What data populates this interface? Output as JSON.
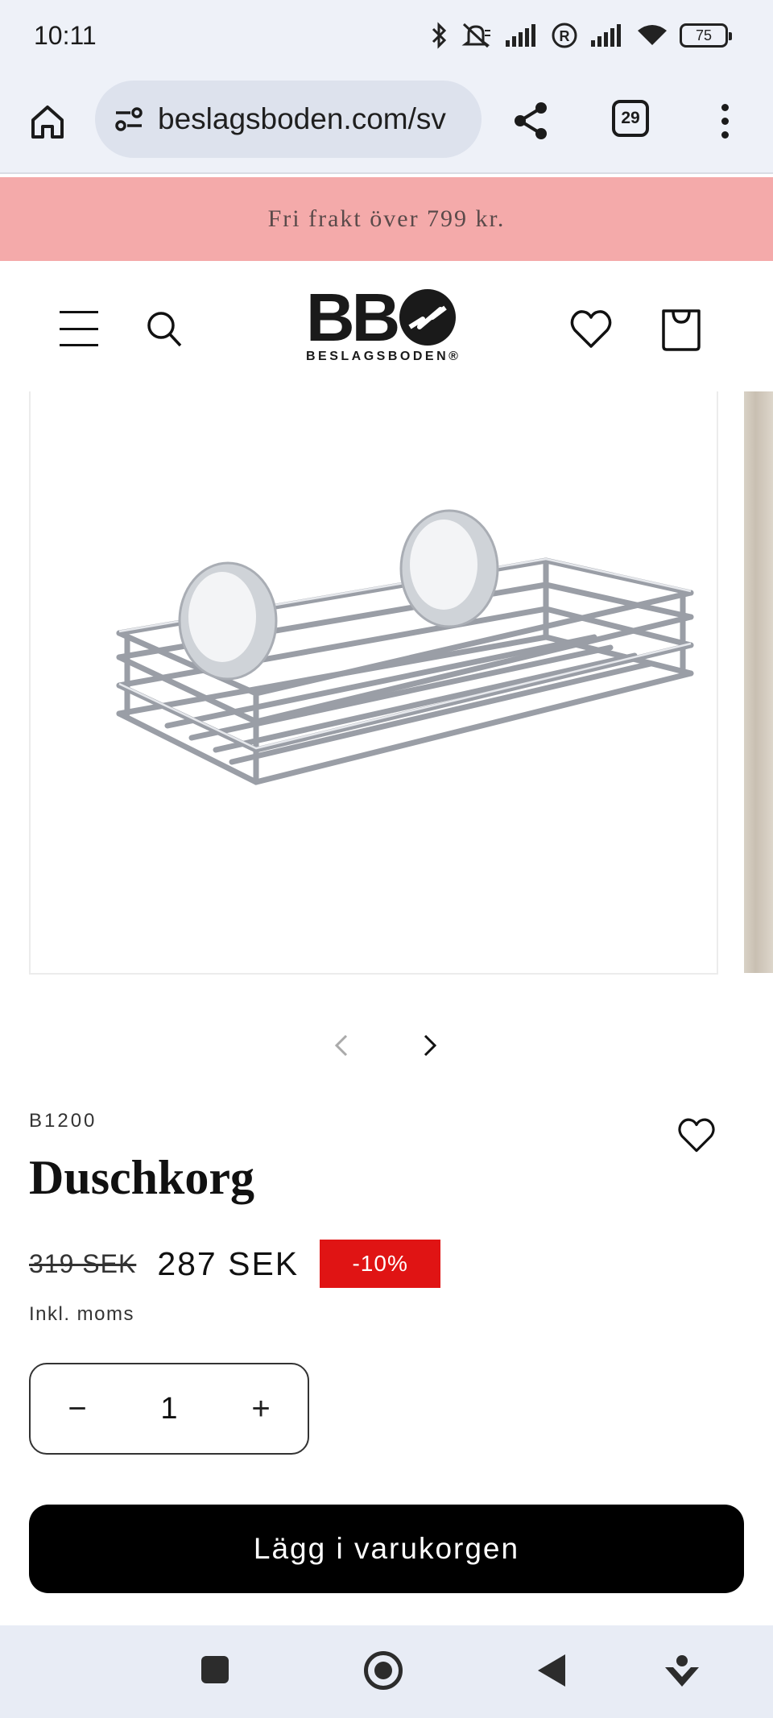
{
  "status_bar": {
    "time": "10:11",
    "battery": "75",
    "icons": [
      "bluetooth-icon",
      "mute-icon",
      "signal-icon",
      "roaming-icon",
      "signal-icon",
      "wifi-icon",
      "battery-icon"
    ]
  },
  "browser": {
    "url": "beslagsboden.com/sv",
    "tab_count": "29"
  },
  "announcement": {
    "text": "Fri frakt över 799 kr."
  },
  "header": {
    "logo_text": "BB",
    "logo_subtitle": "BESLAGSBODEN®"
  },
  "product": {
    "sku": "B1200",
    "title": "Duschkorg",
    "old_price": "319 SEK",
    "new_price": "287 SEK",
    "discount": "-10%",
    "tax_note": "Inkl. moms",
    "quantity": "1",
    "quantity_minus": "−",
    "quantity_plus": "+",
    "add_to_cart": "Lägg i varukorgen"
  },
  "colors": {
    "announcement_bg": "#f4aaaa",
    "discount_badge": "#e01414",
    "button_bg": "#000000"
  }
}
